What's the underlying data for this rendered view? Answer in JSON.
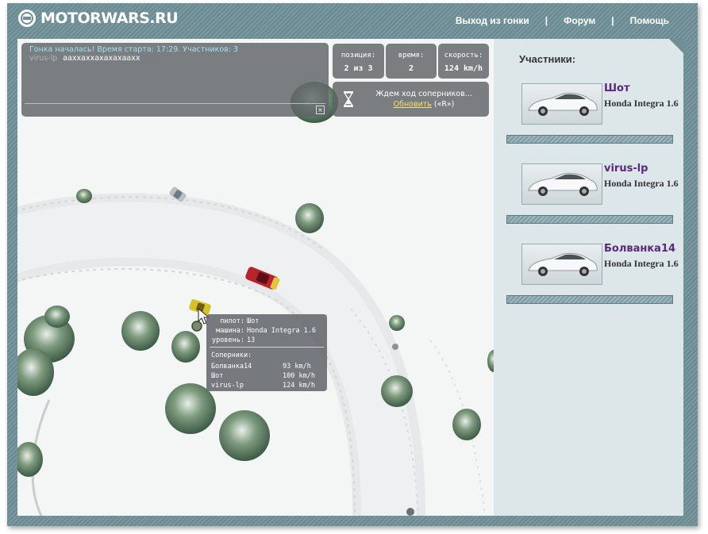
{
  "header": {
    "logo_text": "MOTORWARS.RU",
    "nav": [
      {
        "label": "Выход из гонки"
      },
      {
        "label": "Форум"
      },
      {
        "label": "Помощь"
      }
    ],
    "separator": "|"
  },
  "chat": {
    "system_message": "Гонка началась! Время старта: 17:29. Участников: 3",
    "messages": [
      {
        "author": "virus-lp",
        "text": "ааххаххахахахаахх"
      }
    ],
    "close_symbol": "×"
  },
  "stats": {
    "position": {
      "label": "позиция:",
      "value": "2 из 3"
    },
    "time": {
      "label": "время:",
      "value": "2"
    },
    "speed": {
      "label": "скорость:",
      "value": "124 km/h"
    }
  },
  "waiting": {
    "text": "Ждем ход соперников...",
    "refresh_label": "Обновить",
    "hotkey": "(«R»)"
  },
  "tooltip": {
    "pilot_label": "пилот:",
    "pilot": "Шот",
    "car_label": "машина:",
    "car": "Honda Integra 1.6",
    "level_label": "уровень:",
    "level": "13",
    "rivals_label": "Соперники:",
    "rivals": [
      {
        "name": "Болванка14",
        "speed": "93 km/h"
      },
      {
        "name": "Шот",
        "speed": "100 km/h"
      },
      {
        "name": "virus-lp",
        "speed": "124 km/h"
      }
    ]
  },
  "sidebar": {
    "title": "Участники:",
    "participants": [
      {
        "name": "Шот",
        "car": "Honda Integra 1.6"
      },
      {
        "name": "virus-lp",
        "car": "Honda Integra 1.6"
      },
      {
        "name": "Болванка14",
        "car": "Honda Integra 1.6"
      }
    ]
  },
  "colors": {
    "frame": "#6f8f96",
    "sidebar_bg": "#dde6e8",
    "player_name": "#5a2a7a",
    "link_yellow": "#f6e36a",
    "system_text": "#9fe3ef"
  }
}
